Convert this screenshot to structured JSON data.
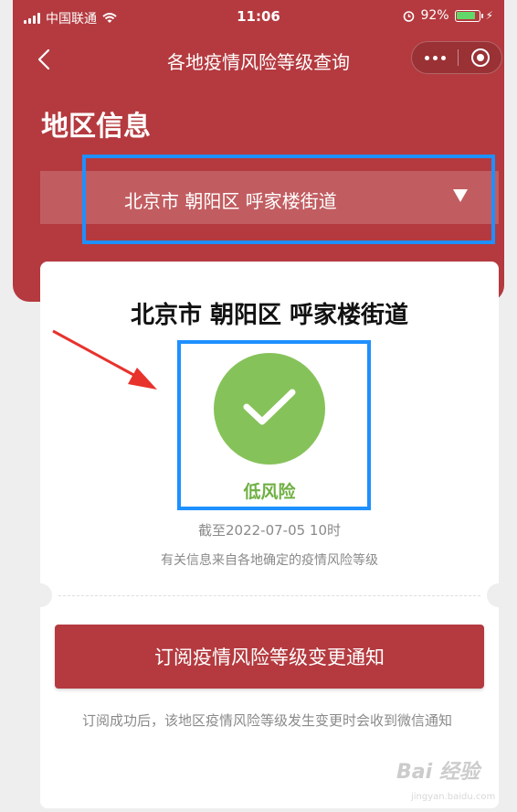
{
  "status_bar": {
    "carrier": "中国联通",
    "time": "11:06",
    "battery_percent": "92%",
    "battery_level": 0.92
  },
  "nav": {
    "title": "各地疫情风险等级查询"
  },
  "region_section": {
    "title": "地区信息",
    "selected_region": "北京市 朝阳区 呼家楼街道"
  },
  "result_card": {
    "region": "北京市 朝阳区 呼家楼街道",
    "risk_level": "低风险",
    "as_of": "截至2022-07-05 10时",
    "source_note": "有关信息来自各地确定的疫情风险等级",
    "subscribe_button": "订阅疫情风险等级变更通知",
    "subscribe_note": "订阅成功后，该地区疫情风险等级发生变更时会收到微信通知"
  },
  "watermark": {
    "brand": "Bai 经验",
    "url": "jingyan.baidu.com"
  },
  "colors": {
    "header_red": "#b43a3f",
    "low_risk_green": "#86c25a",
    "highlight_blue": "#1e90ff",
    "annotation_red": "#e8322c"
  }
}
